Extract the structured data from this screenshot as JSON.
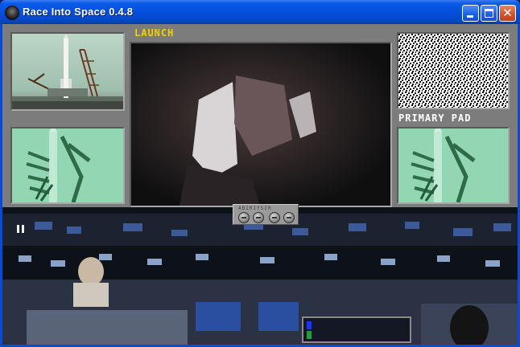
{
  "window": {
    "title": "Race Into Space 0.4.8",
    "controls": {
      "minimize": "",
      "maximize": "",
      "close": "✕"
    }
  },
  "panels": {
    "launch_label": "LAUNCH",
    "primary_pad_label": "PRIMARY PAD"
  },
  "control_panel": {
    "code_text": "ABIRIYSIR"
  },
  "colors": {
    "titlebar": "#0550dc",
    "panel_bg": "#7c7c7c",
    "launch_label": "#f0d000",
    "pad_label": "#ffffff",
    "pad_screen": "#8fd2b0",
    "meter_blue": "#1a34ff",
    "meter_green": "#1fa03a"
  },
  "icons": [
    "app-icon",
    "minimize-icon",
    "maximize-icon",
    "close-icon",
    "pause-icon",
    "rewind-icon",
    "stop-icon",
    "play-icon",
    "fast-forward-icon"
  ]
}
